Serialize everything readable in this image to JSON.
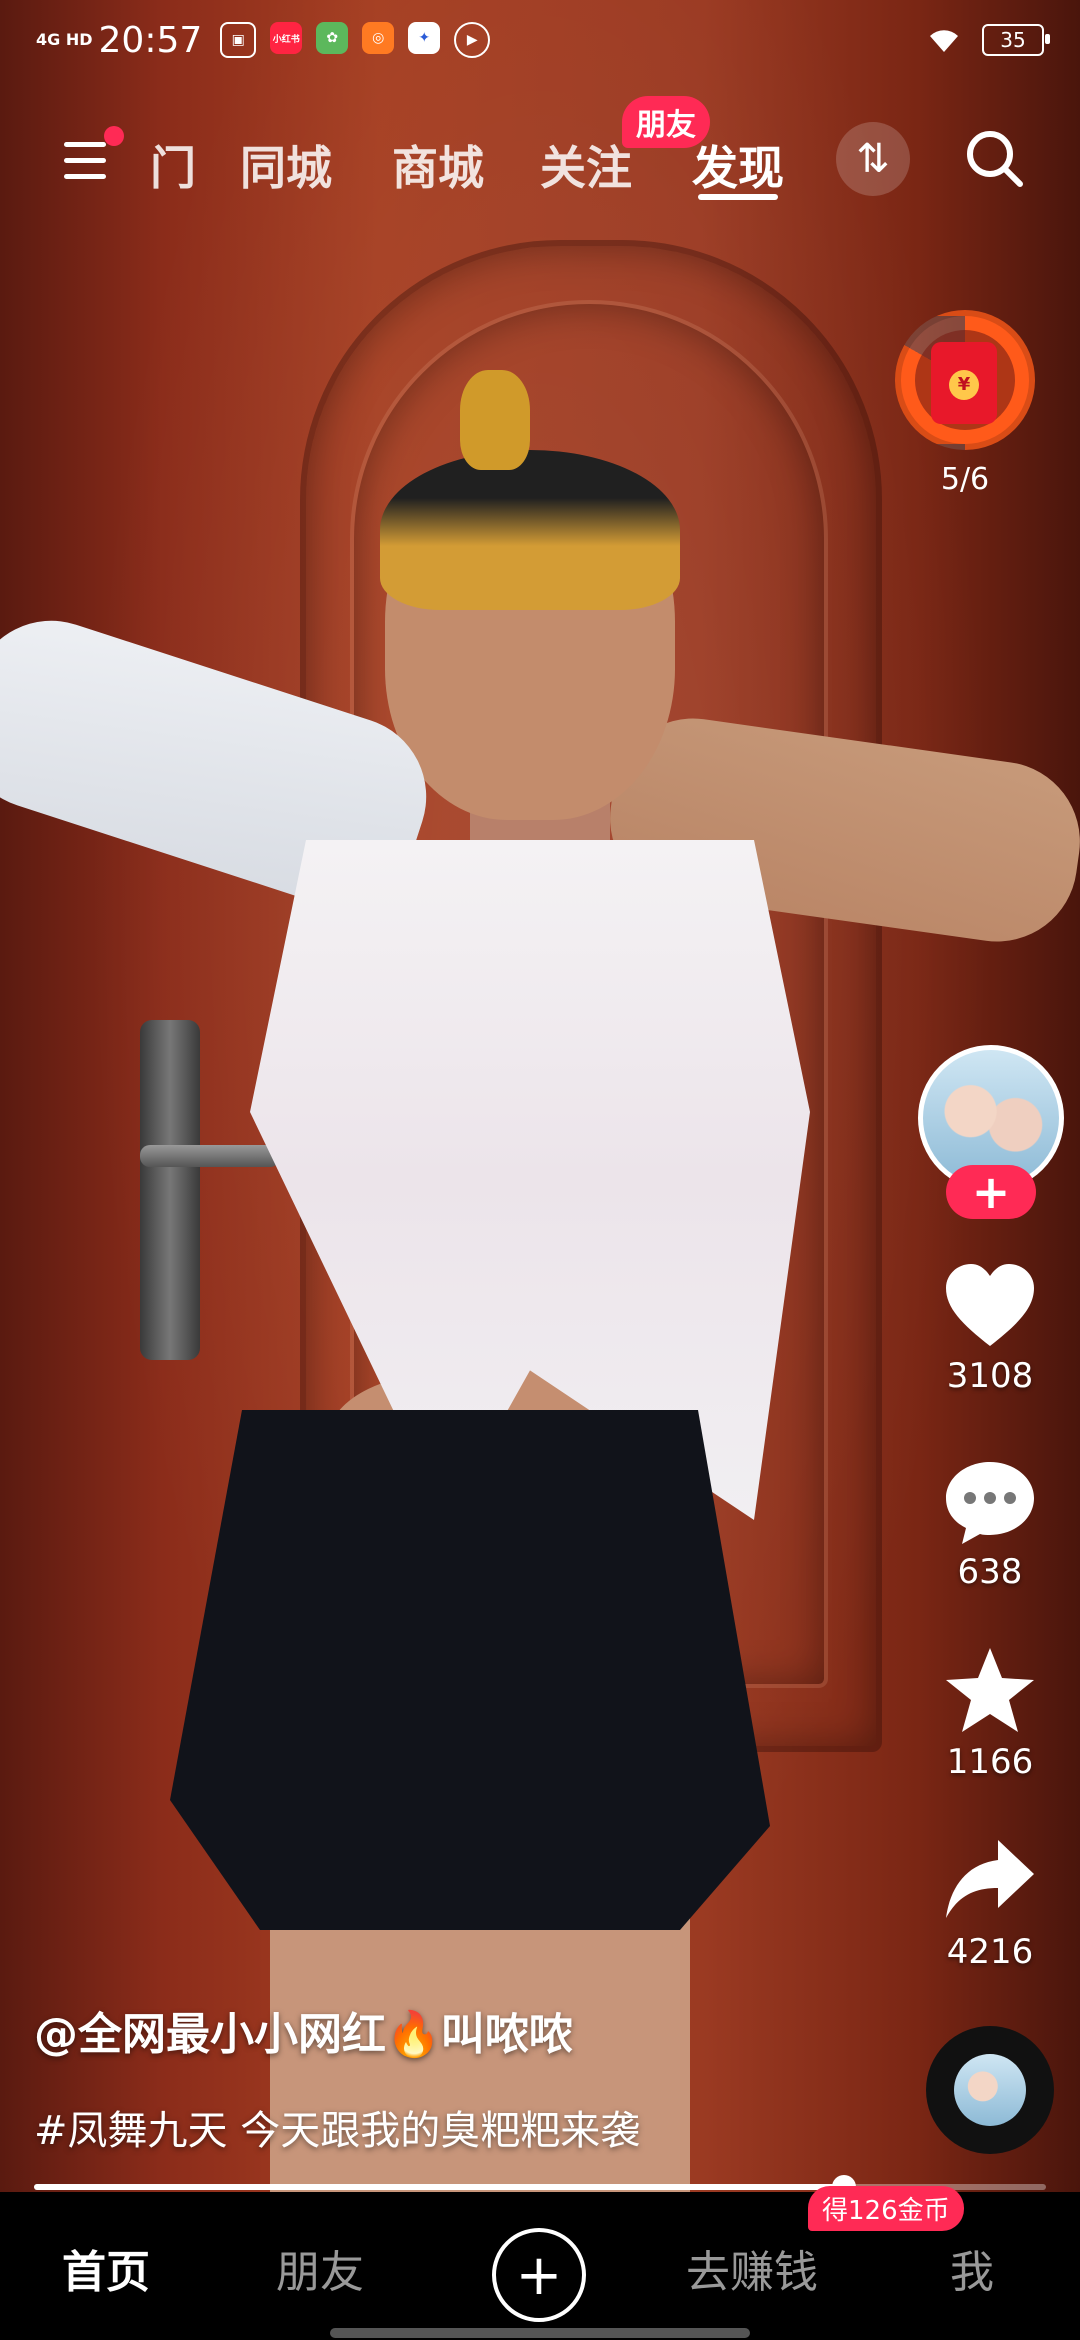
{
  "status_bar": {
    "network": "4G HD",
    "time": "20:57",
    "app_icons": [
      "app-icon-1",
      "xiaohongshu-icon",
      "game-icon",
      "shop-icon",
      "baidu-icon",
      "video-icon"
    ],
    "xiaohongshu_label": "小红书",
    "battery": "35"
  },
  "top_nav": {
    "truncated_tab": "门",
    "tabs": [
      "同城",
      "商城",
      "关注",
      "发现"
    ],
    "active_tab": "发现",
    "friend_badge": "朋友"
  },
  "red_packet": {
    "count": "5/6",
    "progress": 0.83
  },
  "actions": {
    "like_count": "3108",
    "comment_count": "638",
    "favorite_count": "1166",
    "share_count": "4216"
  },
  "caption": {
    "author": "@全网最小小网红🔥叫哝哝",
    "description": "#凤舞九天  今天跟我的臭粑粑来袭"
  },
  "progress": {
    "fraction": 0.8
  },
  "bottom_nav": {
    "home": "首页",
    "friends": "朋友",
    "earn": "去赚钱",
    "me": "我",
    "coin_badge": "得126金币"
  },
  "colors": {
    "accent": "#ff2a55",
    "door": "#8b2c1a"
  }
}
